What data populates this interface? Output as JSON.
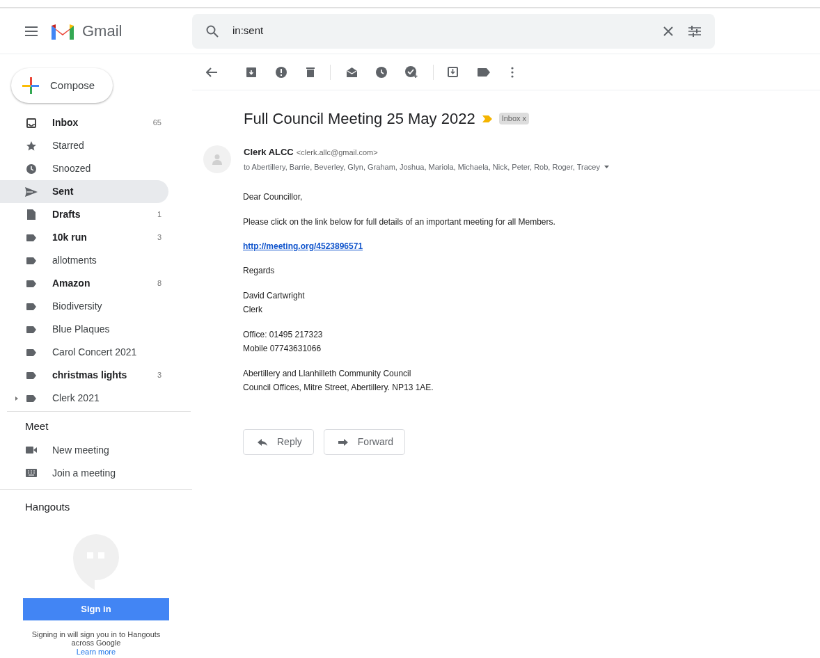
{
  "header": {
    "app_name": "Gmail",
    "search": {
      "value": "in:sent"
    }
  },
  "compose": {
    "label": "Compose"
  },
  "folders": [
    {
      "label": "Inbox",
      "count": "65",
      "unread": true,
      "selected": false
    },
    {
      "label": "Starred",
      "unread": false,
      "selected": false
    },
    {
      "label": "Snoozed",
      "unread": false,
      "selected": false
    },
    {
      "label": "Sent",
      "unread": true,
      "selected": true
    },
    {
      "label": "Drafts",
      "count": "1",
      "unread": true,
      "selected": false
    }
  ],
  "labels": [
    {
      "label": "10k run",
      "count": "3",
      "unread": true,
      "expandable": false
    },
    {
      "label": "allotments",
      "unread": false,
      "expandable": false
    },
    {
      "label": "Amazon",
      "count": "8",
      "unread": true,
      "expandable": false
    },
    {
      "label": "Biodiversity",
      "unread": false,
      "expandable": false
    },
    {
      "label": "Blue Plaques",
      "unread": false,
      "expandable": false
    },
    {
      "label": "Carol Concert 2021",
      "unread": false,
      "expandable": false
    },
    {
      "label": "christmas lights",
      "count": "3",
      "unread": true,
      "expandable": false
    },
    {
      "label": "Clerk 2021",
      "unread": false,
      "expandable": true
    }
  ],
  "meet": {
    "title": "Meet",
    "items": [
      "New meeting",
      "Join a meeting"
    ]
  },
  "hangouts": {
    "title": "Hangouts",
    "sign_in": "Sign in",
    "note": "Signing in will sign you in to Hangouts across Google",
    "learn_more": "Learn more"
  },
  "message": {
    "subject": "Full Council Meeting 25 May 2022",
    "tag": "Inbox",
    "tag_close": "x",
    "sender_name": "Clerk ALCC",
    "sender_email": "<clerk.allc@gmail.com>",
    "recipients": "to Abertillery, Barrie, Beverley, Glyn, Graham, Joshua, Mariola, Michaela, Nick, Peter, Rob, Roger, Tracey",
    "body": [
      {
        "kind": "text",
        "lines": [
          "Dear Councillor,"
        ]
      },
      {
        "kind": "text",
        "lines": [
          "Please click on the link below for full details of an important meeting for all Members."
        ]
      },
      {
        "kind": "link",
        "lines": [
          "http://meeting.org/4523896571"
        ]
      },
      {
        "kind": "text",
        "lines": [
          "Regards"
        ]
      },
      {
        "kind": "text",
        "lines": [
          "David Cartwright",
          "Clerk"
        ]
      },
      {
        "kind": "text",
        "lines": [
          "Office: 01495 217323",
          "Mobile 07743631066"
        ]
      },
      {
        "kind": "text",
        "lines": [
          "Abertillery and Llanhilleth Community Council",
          "Council Offices, Mitre Street, Abertillery. NP13 1AE."
        ]
      }
    ],
    "actions": [
      "Reply",
      "Forward"
    ]
  }
}
